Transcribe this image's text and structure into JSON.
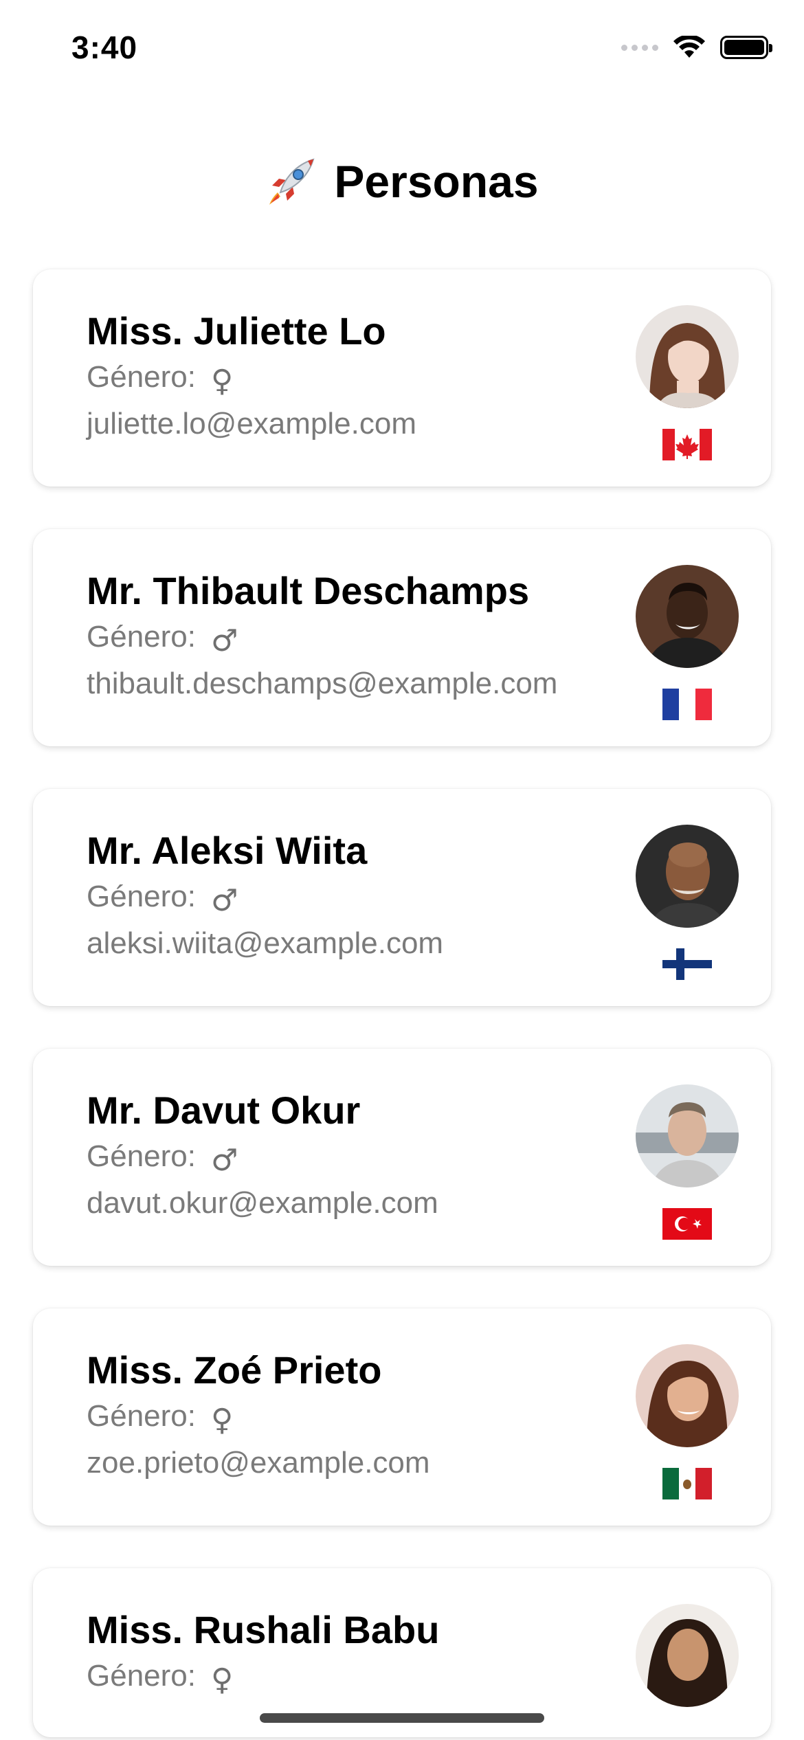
{
  "status_bar": {
    "time": "3:40"
  },
  "header": {
    "emoji": "🚀",
    "title": "Personas"
  },
  "labels": {
    "gender_label": "Género:"
  },
  "people": [
    {
      "name": "Miss. Juliette Lo",
      "gender_symbol": "♀",
      "email": "juliette.lo@example.com",
      "country": "Canada",
      "flag": "canada-flag-icon"
    },
    {
      "name": "Mr. Thibault Deschamps",
      "gender_symbol": "♂",
      "email": "thibault.deschamps@example.com",
      "country": "France",
      "flag": "france-flag-icon"
    },
    {
      "name": "Mr. Aleksi Wiita",
      "gender_symbol": "♂",
      "email": "aleksi.wiita@example.com",
      "country": "Finland",
      "flag": "finland-flag-icon"
    },
    {
      "name": "Mr. Davut Okur",
      "gender_symbol": "♂",
      "email": "davut.okur@example.com",
      "country": "Turkey",
      "flag": "turkey-flag-icon"
    },
    {
      "name": "Miss. Zoé Prieto",
      "gender_symbol": "♀",
      "email": "zoe.prieto@example.com",
      "country": "Mexico",
      "flag": "mexico-flag-icon"
    },
    {
      "name": "Miss. Rushali Babu",
      "gender_symbol": "♀",
      "email": "",
      "country": "",
      "flag": ""
    }
  ],
  "colors": {
    "secondary_text": "#7a7a7a",
    "card_background": "#ffffff"
  }
}
